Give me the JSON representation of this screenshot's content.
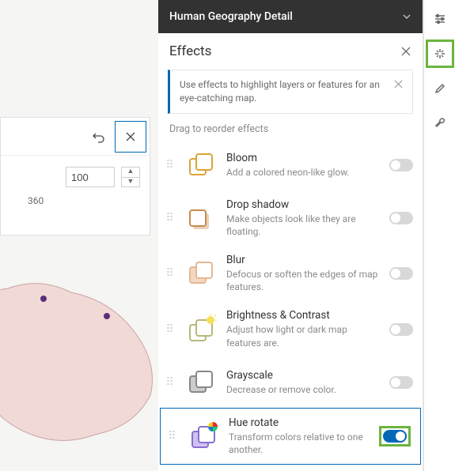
{
  "header": {
    "title": "Human Geography Detail",
    "subtitle": "Effects"
  },
  "tip": {
    "text": "Use effects to highlight layers or features for an eye-catching map."
  },
  "reorder_label": "Drag to reorder effects",
  "popover": {
    "value": "100",
    "scale_max": "360"
  },
  "effects": [
    {
      "name": "Bloom",
      "desc": "Add a colored neon-like glow.",
      "on": false
    },
    {
      "name": "Drop shadow",
      "desc": "Make objects look like they are floating.",
      "on": false
    },
    {
      "name": "Blur",
      "desc": "Defocus or soften the edges of map features.",
      "on": false
    },
    {
      "name": "Brightness & Contrast",
      "desc": "Adjust how light or dark map features are.",
      "on": false
    },
    {
      "name": "Grayscale",
      "desc": "Decrease or remove color.",
      "on": false
    },
    {
      "name": "Hue rotate",
      "desc": "Transform colors relative to one another.",
      "on": true
    }
  ],
  "icons": {
    "bloom_color": "#d9a438",
    "drop_color": "#c98b4d",
    "blur_color": "#e8b78f",
    "bright_color": "#d6d6a8",
    "gray_color": "#a8a8a8",
    "hue_color": "#8a6fcf"
  }
}
